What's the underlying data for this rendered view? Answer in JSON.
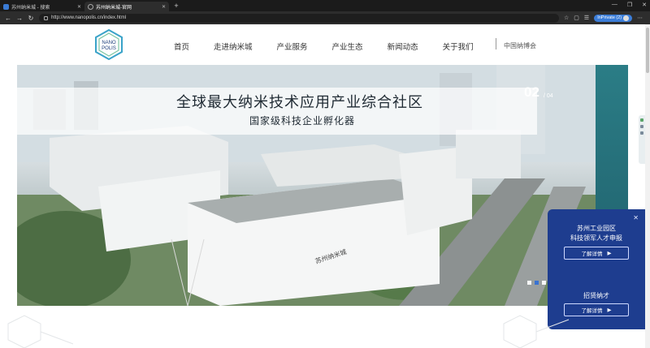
{
  "browser": {
    "tabs": [
      {
        "label": "苏州纳米城 - 搜索",
        "active": false
      },
      {
        "label": "苏州纳米城-官网",
        "active": true
      }
    ],
    "url": "http://www.nanopolis.cn/index.html",
    "profile_label": "InPrivate (2)"
  },
  "site": {
    "logo_text_top": "NANO",
    "logo_text_bottom": "POLIS",
    "nav": [
      "首页",
      "走进纳米城",
      "产业服务",
      "产业生态",
      "新闻动态",
      "关于我们"
    ],
    "nav_extra": "中国纳博会"
  },
  "hero": {
    "title": "全球最大纳米技术应用产业综合社区",
    "subtitle": "国家级科技企业孵化器",
    "slide_current": "02",
    "slide_total": "/ 04",
    "building_sign": "苏州纳米城"
  },
  "float_panel": {
    "line1": "苏州工业园区",
    "line2": "科技领军人才申报",
    "btn1": "了解详情",
    "line3": "招贤纳才",
    "btn2": "了解详情"
  },
  "colors": {
    "panel_bg": "#1e3d8f",
    "dot_active": "#2f6ed7",
    "teal_accent": "#2b7d86"
  }
}
